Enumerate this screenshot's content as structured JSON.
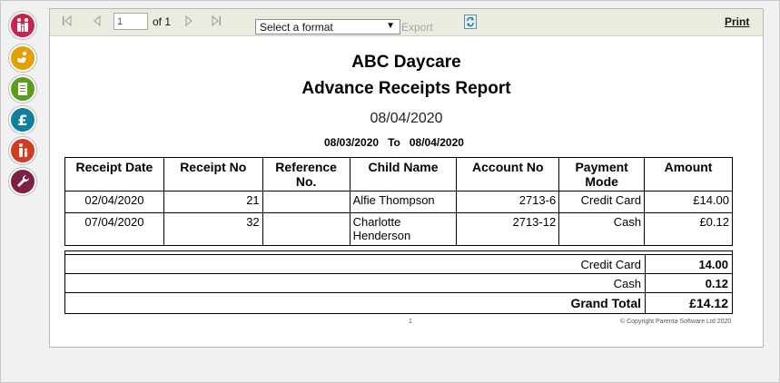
{
  "toolbar": {
    "page_value": "1",
    "of_label": "of 1",
    "format_selected": "Select a format",
    "export_label": "Export",
    "print_label": "Print"
  },
  "sidebar": {
    "items": [
      {
        "icon": "family-icon",
        "color": "#c8254e"
      },
      {
        "icon": "child-play-icon",
        "color": "#e2a100"
      },
      {
        "icon": "document-icon",
        "color": "#5a9e1c"
      },
      {
        "icon": "pound-icon",
        "color": "#117f9c"
      },
      {
        "icon": "parent-child-icon",
        "color": "#d33a22"
      },
      {
        "icon": "wrench-icon",
        "color": "#7e1f46"
      }
    ]
  },
  "report": {
    "title": "ABC Daycare",
    "subtitle": "Advance Receipts Report",
    "date": "08/04/2020",
    "range_from": "08/03/2020",
    "range_to_label": "To",
    "range_to": "08/04/2020",
    "columns": [
      "Receipt Date",
      "Receipt No",
      "Reference No.",
      "Child Name",
      "Account No",
      "Payment Mode",
      "Amount"
    ],
    "rows": [
      {
        "receipt_date": "02/04/2020",
        "receipt_no": "21",
        "reference_no": "",
        "child_name": "Alfie Thompson",
        "account_no": "2713-6",
        "payment_mode": "Credit Card",
        "amount": "£14.00"
      },
      {
        "receipt_date": "07/04/2020",
        "receipt_no": "32",
        "reference_no": "",
        "child_name": "Charlotte Henderson",
        "account_no": "2713-12",
        "payment_mode": "Cash",
        "amount": "£0.12"
      }
    ],
    "totals": [
      {
        "label": "Credit Card",
        "value": "14.00"
      },
      {
        "label": "Cash",
        "value": "0.12"
      }
    ],
    "grand_total_label": "Grand Total",
    "grand_total_value": "£14.12",
    "page_number": "1",
    "copyright": "© Copyright Parenta Software Ltd 2020"
  }
}
